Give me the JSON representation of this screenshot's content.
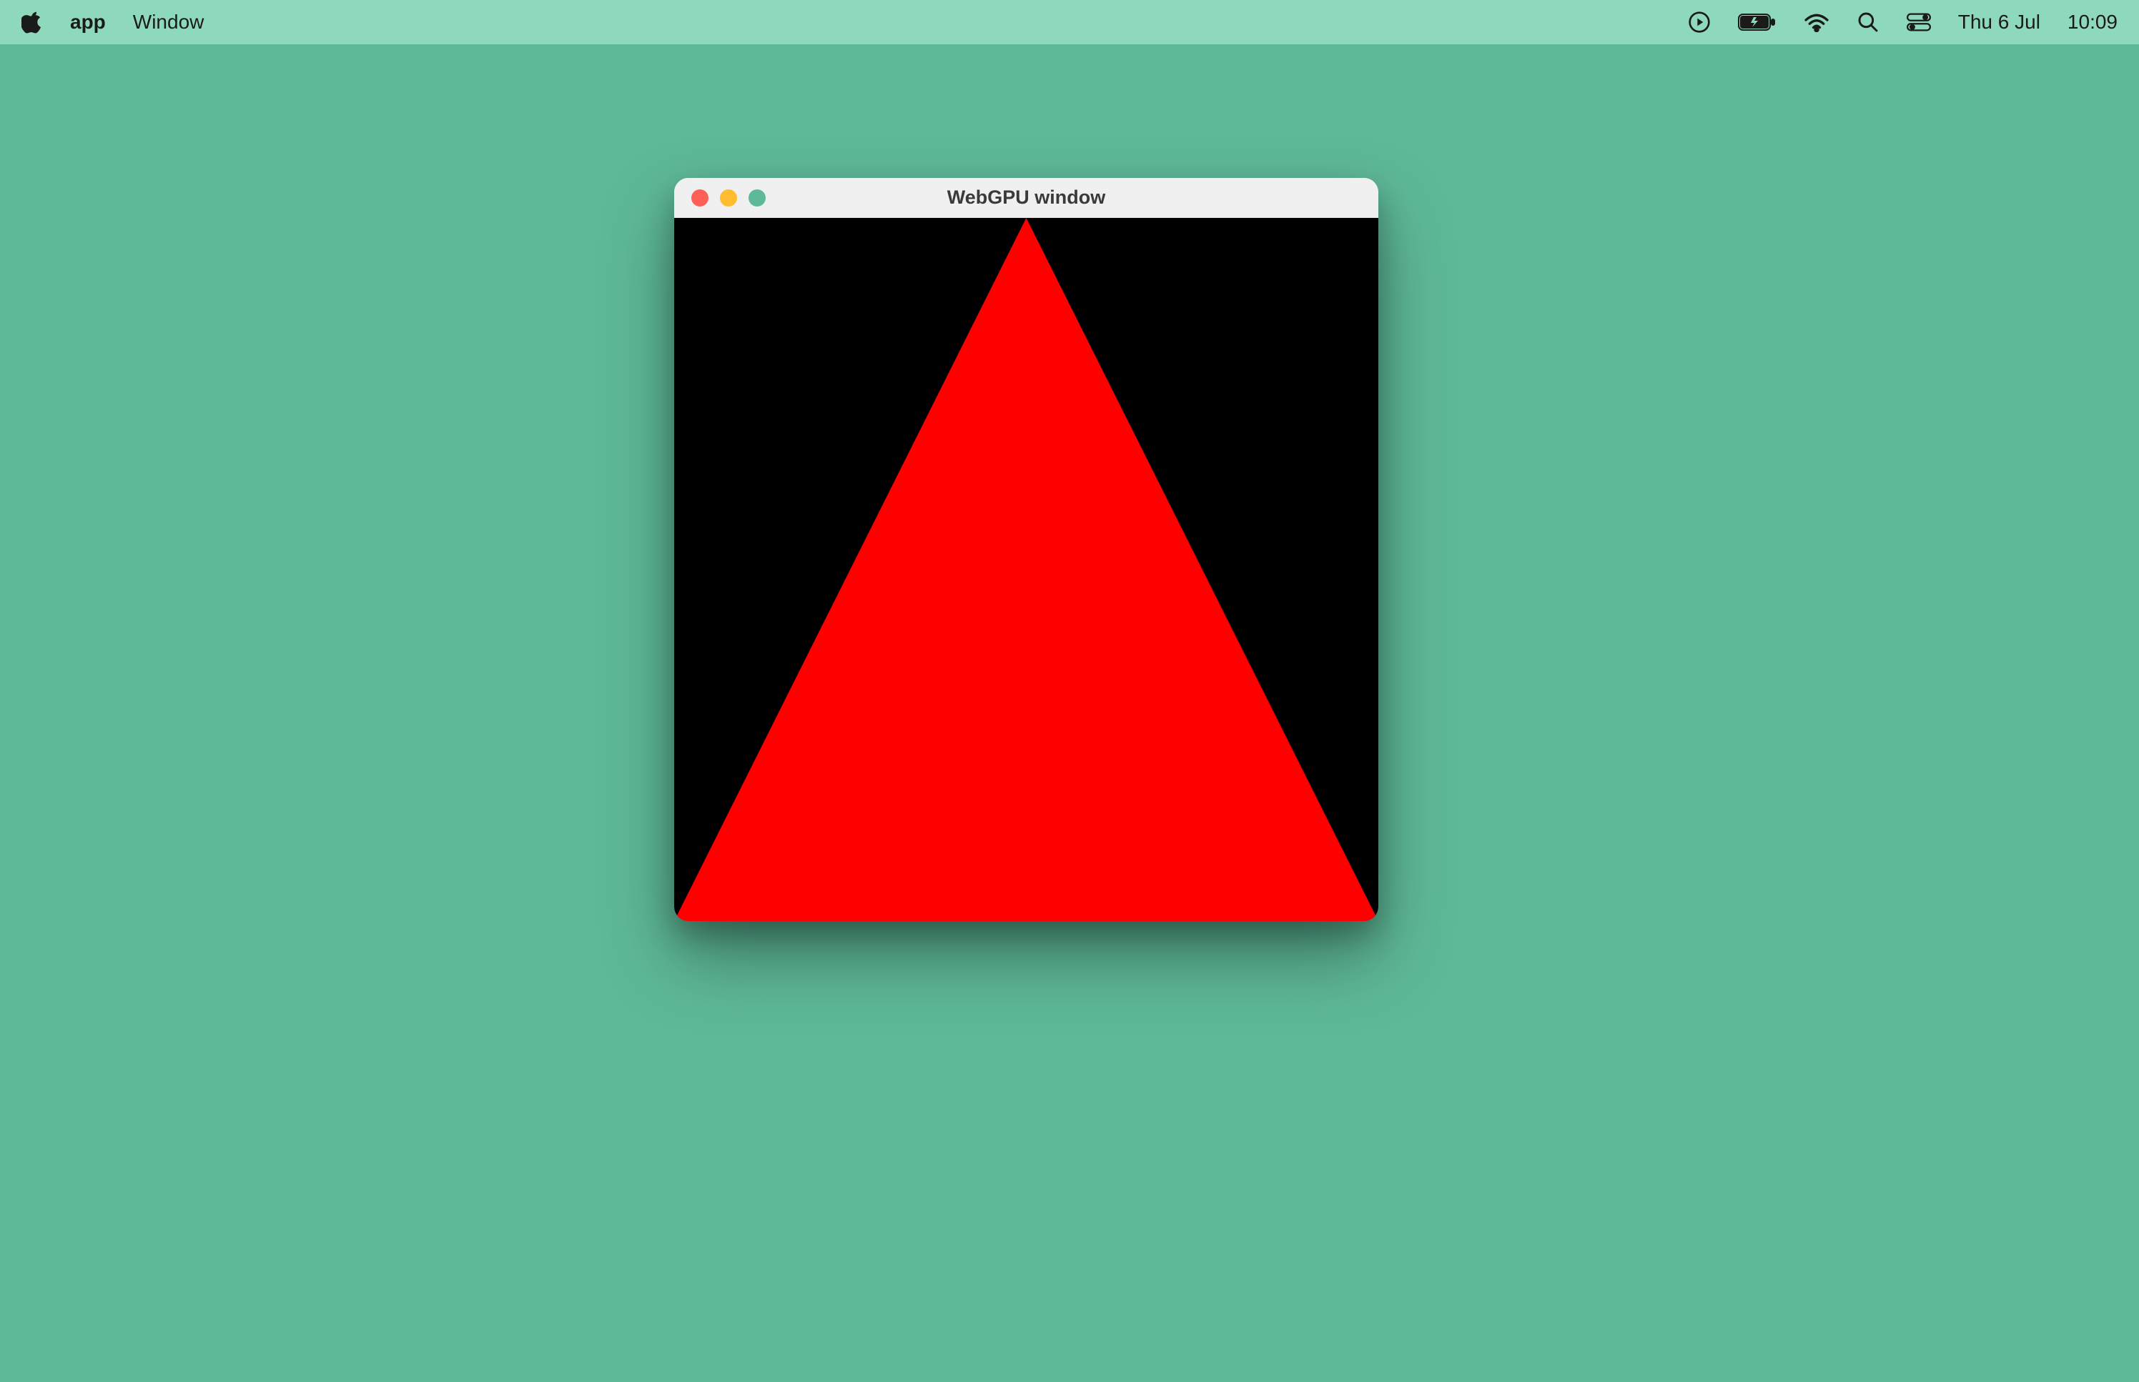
{
  "menubar": {
    "app_name": "app",
    "items": [
      "Window"
    ],
    "date": "Thu 6 Jul",
    "time": "10:09"
  },
  "window": {
    "title": "WebGPU window",
    "colors": {
      "background": "#000000",
      "triangle": "#ff0000"
    }
  }
}
